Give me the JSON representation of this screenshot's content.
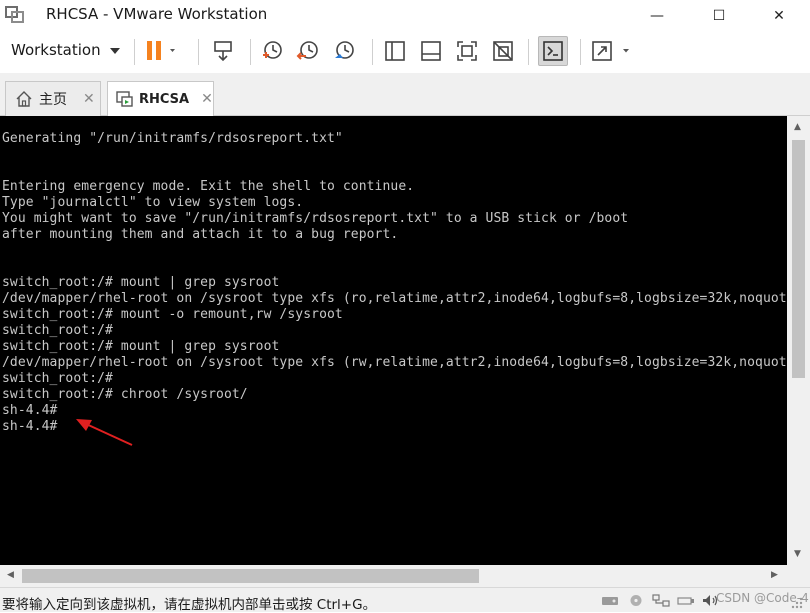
{
  "window": {
    "title": "RHCSA - VMware Workstation",
    "minimize": "—",
    "maximize": "☐",
    "close": "✕"
  },
  "toolbar": {
    "workstation_menu": "Workstation"
  },
  "tabs": [
    {
      "label": "主页",
      "close": "✕"
    },
    {
      "label": "RHCSA",
      "close": "✕"
    }
  ],
  "console": {
    "lines": [
      "Generating \"/run/initramfs/rdsosreport.txt\"",
      "",
      "",
      "Entering emergency mode. Exit the shell to continue.",
      "Type \"journalctl\" to view system logs.",
      "You might want to save \"/run/initramfs/rdsosreport.txt\" to a USB stick or /boot",
      "after mounting them and attach it to a bug report.",
      "",
      "",
      "switch_root:/# mount | grep sysroot",
      "/dev/mapper/rhel-root on /sysroot type xfs (ro,relatime,attr2,inode64,logbufs=8,logbsize=32k,noquota)",
      "switch_root:/# mount -o remount,rw /sysroot",
      "switch_root:/#",
      "switch_root:/# mount | grep sysroot",
      "/dev/mapper/rhel-root on /sysroot type xfs (rw,relatime,attr2,inode64,logbufs=8,logbsize=32k,noquota)",
      "switch_root:/#",
      "switch_root:/# chroot /sysroot/",
      "sh-4.4#",
      "sh-4.4#"
    ]
  },
  "status": {
    "message": "要将输入定向到该虚拟机，请在虚拟机内部单击或按 Ctrl+G。",
    "watermark": "CSDN @Code-4"
  },
  "colors": {
    "pause_accent": "#f5821f",
    "annotation_arrow": "#e02020",
    "console_bg": "#000000",
    "console_text": "#c8c8c8"
  }
}
